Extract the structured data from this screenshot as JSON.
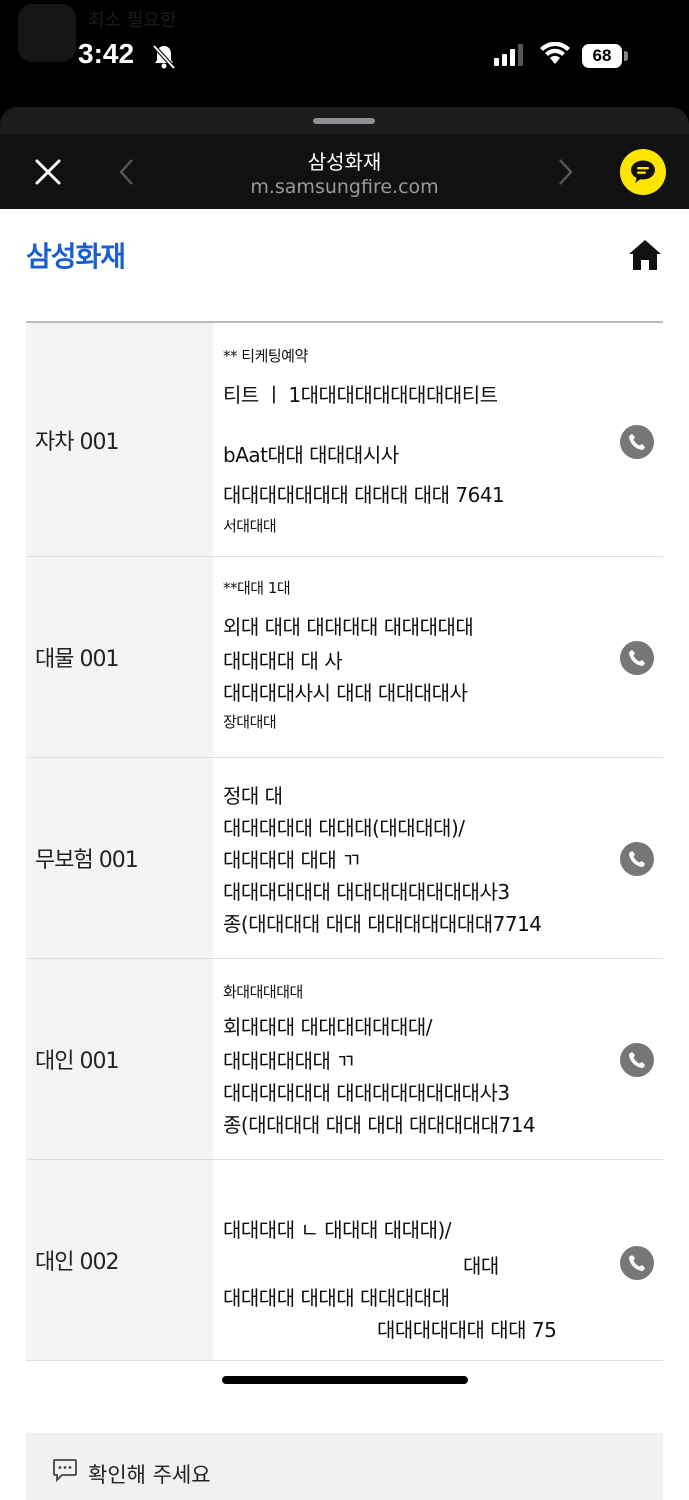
{
  "status_bar": {
    "ghost_label": "최소 필요한",
    "time": "3:42",
    "battery": "68"
  },
  "browser": {
    "title": "삼성화재",
    "url": "m.samsungfire.com"
  },
  "page": {
    "brand": "삼성화재",
    "rows": [
      {
        "label": "자차 001",
        "lines": [
          "** 티케팅예약",
          "티트   ㅣ   1대대대대대대대대대티트",
          "bAat대대 대대대시사",
          "대대대대대대대 대대대  대대 7641",
          "서대대대"
        ]
      },
      {
        "label": "대물 001",
        "lines": [
          "**대대     1대",
          "외대 대대 대대대대 대대대대대",
          "대대대대 대   사",
          "대대대대사시 대대 대대대대사",
          "장대대대"
        ]
      },
      {
        "label": "무보험 001",
        "lines": [
          "정대 대",
          "대대대대대   대대대(대대대대)/",
          "대대대대 대대   ㄲ",
          "대대대대대대  대대대대대대대대사3",
          "종(대대대대 대대 대대대대대대대7714"
        ]
      },
      {
        "label": "대인 001",
        "lines": [
          "화대대대대대",
          "회대대대   대대대대대대대/",
          "대대대대대대   ㄲ",
          "대대대대대대  대대대대대대대대사3",
          "종(대대대대 대대 대대 대대대대대714"
        ]
      },
      {
        "label": "대인 002",
        "lines": [
          "대대대대 ㄴ   대대대 대대대)/",
          "대대",
          "대대대대     대대대 대대대대대",
          "대대대대대대 대대 75"
        ]
      }
    ],
    "confirm_text": "확인해 주세요"
  },
  "colors": {
    "brand_blue": "#1a5fd0",
    "talk_yellow": "#fee500"
  },
  "icons": [
    "bell-off-icon",
    "signal-icon",
    "wifi-icon",
    "close-icon",
    "chevron-left-icon",
    "chevron-right-icon",
    "kakaotalk-icon",
    "home-icon",
    "phone-icon",
    "chat-icon"
  ]
}
